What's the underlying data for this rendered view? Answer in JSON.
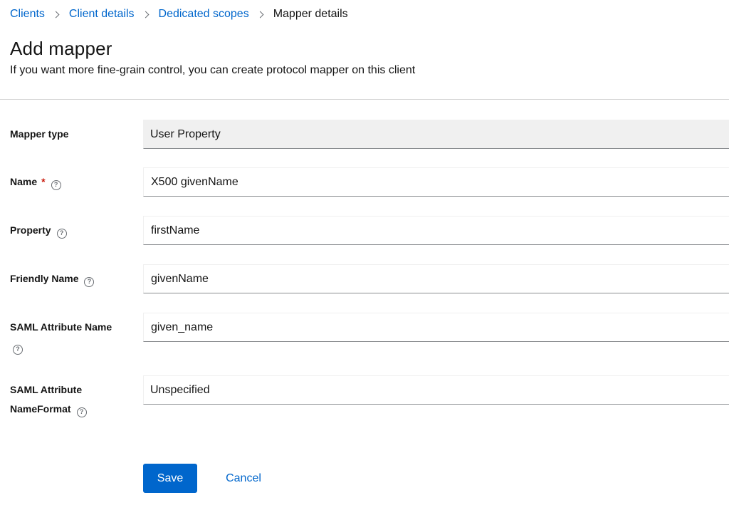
{
  "breadcrumb": {
    "items": [
      "Clients",
      "Client details",
      "Dedicated scopes"
    ],
    "current": "Mapper details"
  },
  "header": {
    "title": "Add mapper",
    "subtitle": "If you want more fine-grain control, you can create protocol mapper on this client"
  },
  "form": {
    "mapper_type": {
      "label": "Mapper type",
      "value": "User Property"
    },
    "name": {
      "label": "Name",
      "required_mark": "*",
      "value": "X500 givenName"
    },
    "property": {
      "label": "Property",
      "value": "firstName"
    },
    "friendly_name": {
      "label": "Friendly Name",
      "value": "givenName"
    },
    "saml_attribute_name": {
      "label": "SAML Attribute Name",
      "value": "given_name"
    },
    "saml_attribute_nameformat": {
      "label_line1": "SAML Attribute",
      "label_line2": "NameFormat",
      "value": "Unspecified"
    },
    "help_glyph": "?"
  },
  "actions": {
    "save_label": "Save",
    "cancel_label": "Cancel"
  },
  "colors": {
    "primary": "#0066cc",
    "required": "#c9190b",
    "readonly_bg": "#f0f0f0"
  }
}
